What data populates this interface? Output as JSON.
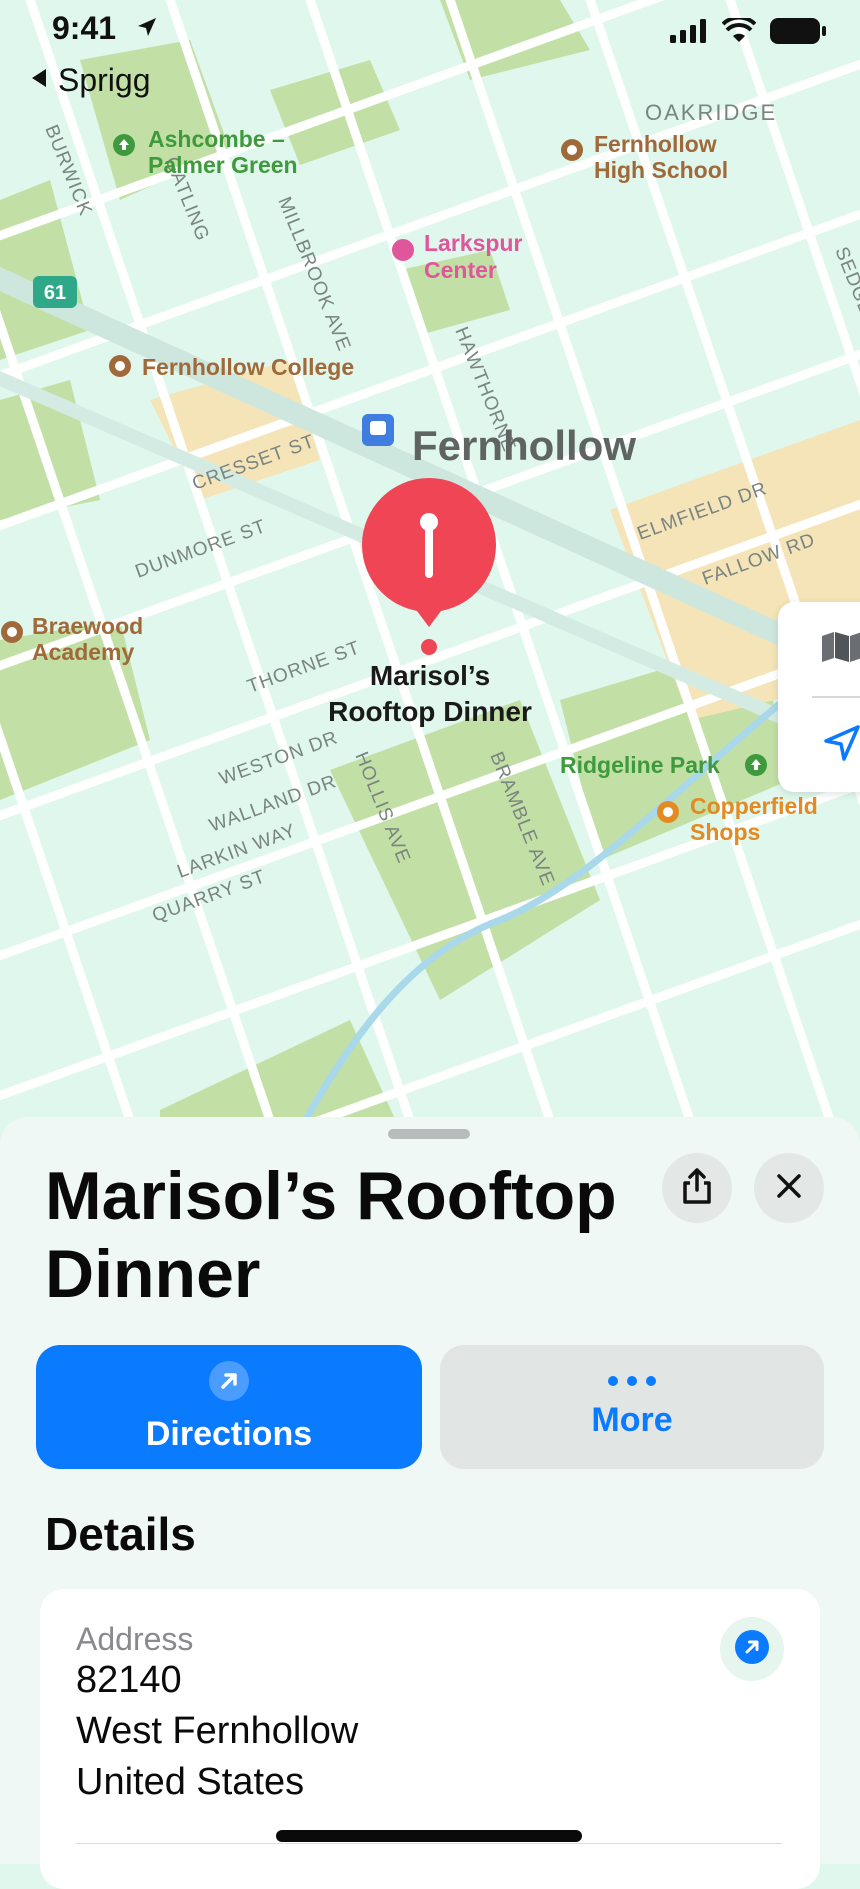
{
  "status_bar": {
    "time": "9:41"
  },
  "nav": {
    "back_label": "Sprigg"
  },
  "map": {
    "district_labels": {
      "oakridge": "OAKRIDGE",
      "fernhollow": "Fernhollow"
    },
    "route_shield": "61",
    "pois": {
      "ashcombe_1": "Ashcombe –",
      "ashcombe_2": "Palmer Green",
      "fernhollow_hs_1": "Fernhollow",
      "fernhollow_hs_2": "High School",
      "larkspur_1": "Larkspur",
      "larkspur_2": "Center",
      "fernhollow_college": "Fernhollow College",
      "braewood_1": "Braewood",
      "braewood_2": "Academy",
      "ridgeline": "Ridgeline Park",
      "copperfield_1": "Copperfield",
      "copperfield_2": "Shops",
      "pin_1": "Marisol’s",
      "pin_2": "Rooftop Dinner"
    },
    "streets": {
      "burwick": "BURWICK",
      "gatling": "GATLING",
      "millbrook": "MILLBROOK AVE",
      "hawthorne": "HAWTHORNE",
      "sedge": "SEDGE",
      "cresset": "CRESSET ST",
      "dunmore": "DUNMORE ST",
      "elmfield": "ELMFIELD DR",
      "fallow": "FALLOW RD",
      "thorne": "THORNE ST",
      "weston": "WESTON DR",
      "walland": "WALLAND DR",
      "larkin": "LARKIN WAY",
      "quarry": "QUARRY ST",
      "hollis": "HOLLIS AVE",
      "bramble": "BRAMBLE AVE"
    },
    "icons": {
      "map_mode": "map-icon",
      "locate": "location-arrow-icon"
    }
  },
  "sheet": {
    "title": "Marisol’s Rooftop Dinner",
    "directions_label": "Directions",
    "more_label": "More",
    "details_heading": "Details",
    "address": {
      "label": "Address",
      "line1": "82140",
      "line2": "West Fernhollow",
      "line3": "United States"
    }
  },
  "colors": {
    "accent": "#0a7aff",
    "pin": "#ef4555",
    "park": "#c2e0a6",
    "map_base": "#dff7ec",
    "school": "#a0693a",
    "poi_green": "#3e9a3c",
    "poi_pink": "#e0569a",
    "poi_orange": "#e48a22"
  }
}
